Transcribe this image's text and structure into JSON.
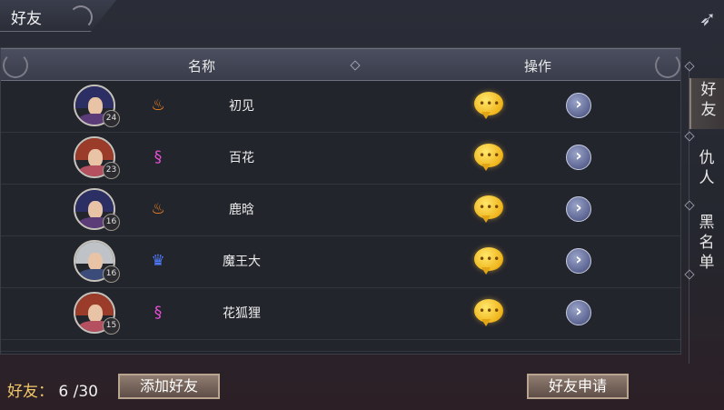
{
  "window": {
    "title": "好友",
    "close_icon": "swallow-close-icon"
  },
  "table": {
    "col_name": "名称",
    "col_action": "操作",
    "rows": [
      {
        "name": "初见",
        "level": "24",
        "faction_color": "#ff8a1e",
        "faction_icon": "flame-icon",
        "hair": "#2c2f64",
        "outfit": "#5b3c78"
      },
      {
        "name": "百花",
        "level": "23",
        "faction_color": "#e64fd3",
        "faction_icon": "swirl-icon",
        "hair": "#9b3b2a",
        "outfit": "#b4505f"
      },
      {
        "name": "鹿晗",
        "level": "16",
        "faction_color": "#ff8a1e",
        "faction_icon": "flame-icon",
        "hair": "#2c2f64",
        "outfit": "#5b3c78"
      },
      {
        "name": "魔王大",
        "level": "16",
        "faction_color": "#4f7dff",
        "faction_icon": "crown-icon",
        "hair": "#bfc3c7",
        "outfit": "#3c4c7a"
      },
      {
        "name": "花狐狸",
        "level": "15",
        "faction_color": "#e64fd3",
        "faction_icon": "swirl-icon",
        "hair": "#9b3b2a",
        "outfit": "#b4505f"
      }
    ]
  },
  "side_tabs": [
    {
      "label": "好\n友",
      "active": true
    },
    {
      "label": "仇\n人",
      "active": false
    },
    {
      "label": "黑\n名\n单",
      "active": false
    }
  ],
  "footer": {
    "count_label": "好友：",
    "count_value": "6 /30",
    "add_button": "添加好友",
    "requests_button": "好友申请"
  }
}
